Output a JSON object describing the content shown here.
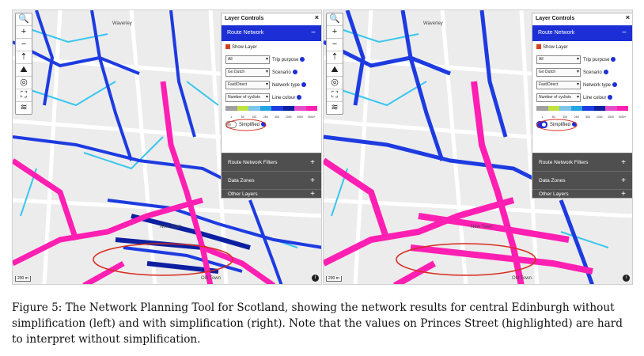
{
  "panels": [
    {
      "id": "left",
      "map_labels": {
        "waverley": "Waverley",
        "new_town": "New Town",
        "old_town": "Old Town"
      },
      "zoom": {
        "search": "🔍",
        "plus": "+",
        "minus": "−"
      },
      "controls": {
        "title": "Layer Controls",
        "close": "×",
        "section": "Route Network",
        "section_sign": "−",
        "show_layer": "Show Layer",
        "trip_purpose_value": "All",
        "trip_purpose_label": "Trip purpose",
        "scenario_value": "Go Dutch",
        "scenario_label": "Scenario",
        "network_type_value": "Fast/Direct",
        "network_type_label": "Network type",
        "line_colour_value": "Number of cyclists",
        "line_colour_label": "Line colour",
        "legend_ticks": [
          "1",
          "50",
          "100",
          "250",
          "500",
          "1000",
          "2000",
          "3000+"
        ],
        "simplified_label": "Simplified",
        "simplified_on": false,
        "filters": "Route Network Filters",
        "data_zones": "Data Zones",
        "other_layers": "Other Layers",
        "plus": "+"
      },
      "scale": "200 m",
      "info": "i"
    },
    {
      "id": "right",
      "map_labels": {
        "waverley": "Waverley",
        "new_town": "New Town",
        "old_town": "Old Town"
      },
      "zoom": {
        "search": "🔍",
        "plus": "+",
        "minus": "−"
      },
      "controls": {
        "title": "Layer Controls",
        "close": "×",
        "section": "Route Network",
        "section_sign": "−",
        "show_layer": "Show Layer",
        "trip_purpose_value": "All",
        "trip_purpose_label": "Trip purpose",
        "scenario_value": "Go Dutch",
        "scenario_label": "Scenario",
        "network_type_value": "Fast/Direct",
        "network_type_label": "Network type",
        "line_colour_value": "Number of cyclists",
        "line_colour_label": "Line colour",
        "legend_ticks": [
          "1",
          "50",
          "100",
          "250",
          "500",
          "1000",
          "2000",
          "3000+"
        ],
        "simplified_label": "Simplified",
        "simplified_on": true,
        "filters": "Route Network Filters",
        "data_zones": "Data Zones",
        "other_layers": "Other Layers",
        "plus": "+"
      },
      "scale": "200 m",
      "info": "i"
    }
  ],
  "colors": {
    "legend": [
      "#a0a0a0",
      "#bfe23f",
      "#7cc7e9",
      "#23a5e6",
      "#1d3be0",
      "#0c1fa0",
      "#e54cc8",
      "#ff1fb2"
    ],
    "accent": "#1c2fd6",
    "highlight": "#d62d20"
  },
  "caption": "Figure 5: The Network Planning Tool for Scotland, showing the network results for central Edinburgh without simplification (left) and with simplification (right). Note that the values on Princes Street (highlighted) are hard to interpret without simplification."
}
